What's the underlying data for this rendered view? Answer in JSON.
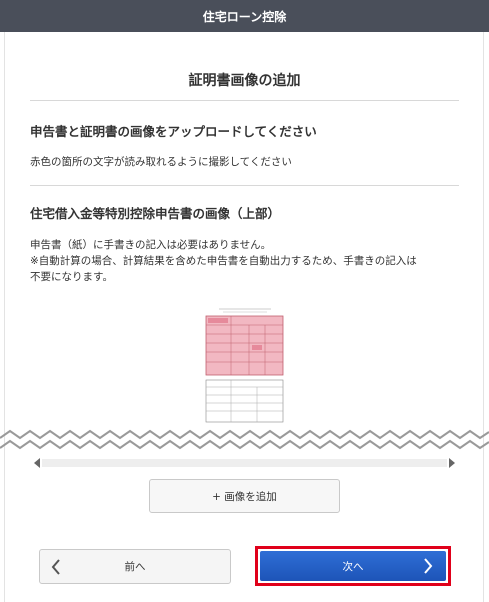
{
  "header": {
    "title": "住宅ローン控除"
  },
  "section": {
    "title": "証明書画像の追加"
  },
  "upload": {
    "heading": "申告書と証明書の画像をアップロードしてください",
    "note": "赤色の箇所の文字が読み取れるように撮影してください"
  },
  "image_block": {
    "heading": "住宅借入金等特別控除申告書の画像（上部）",
    "lines": [
      "申告書（紙）に手書きの記入は必要はありません。",
      "※自動計算の場合、計算結果を含めた申告書を自動出力するため、手書きの記入は",
      "不要になります。"
    ]
  },
  "buttons": {
    "add_image": "+ 画像を追加",
    "prev": "前へ",
    "next": "次へ"
  },
  "icons": {
    "prev": "chevron-left-icon",
    "next": "chevron-right-icon",
    "scroll_left": "scroll-left-arrow-icon",
    "scroll_right": "scroll-right-arrow-icon"
  },
  "colors": {
    "header_bg": "#4a4f5a",
    "highlight_border": "#e0001a",
    "primary_button": "#1d54b8",
    "form_highlight": "#f2b8c2"
  }
}
